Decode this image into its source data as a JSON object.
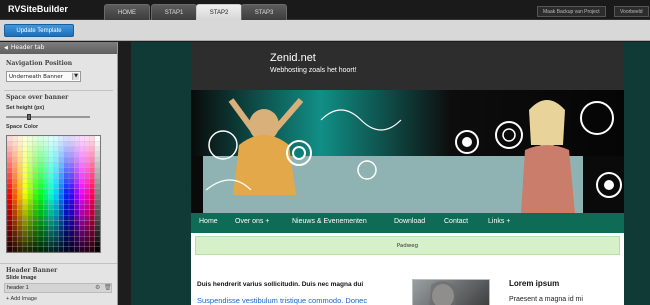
{
  "app": {
    "title": "RVSiteBuilder"
  },
  "tabs": [
    {
      "label": "HOME",
      "active": false
    },
    {
      "label": "STAP1",
      "active": false
    },
    {
      "label": "STAP2",
      "active": true
    },
    {
      "label": "STAP3",
      "active": false
    }
  ],
  "top_buttons": {
    "backup": "Maak Backup van Project",
    "preview": "Voorbeeld"
  },
  "toolbar": {
    "update_label": "Update Template"
  },
  "panel": {
    "header_tab": "Header tab",
    "nav_position_title": "Navigation Position",
    "nav_position_value": "Underneath Banner",
    "space_title": "Space over banner",
    "set_height_label": "Set height (px)",
    "set_height_fraction": 0.26,
    "space_color_label": "Space Color",
    "header_banner_title": "Header Banner",
    "slide_image_label": "Slide Image",
    "slide_item": "header 1",
    "add_image": "Add Image"
  },
  "site": {
    "title": "Zenid.net",
    "subtitle": "Webhosting zoals het hoort!",
    "nav": [
      "Home",
      "Over ons +",
      "Nieuws & Evenementen",
      "Download",
      "Contact",
      "Links +"
    ],
    "breadcrumb": "Padweg",
    "content_bold": "Duis hendrerit varius sollicitudin. Duis nec magna dui",
    "content_link": "Suspendisse vestibulum tristique commodo. Donec",
    "sidebar_heading": "Lorem ipsum",
    "sidebar_text": "Praesent a magna id mi"
  },
  "colors": {
    "preview_bg": "#0f3a35",
    "nav_green": "#0e6b55",
    "breadcrumb_bg": "#d6f0c9",
    "update_blue": "#2a82c9",
    "link_blue": "#1a63c8"
  }
}
